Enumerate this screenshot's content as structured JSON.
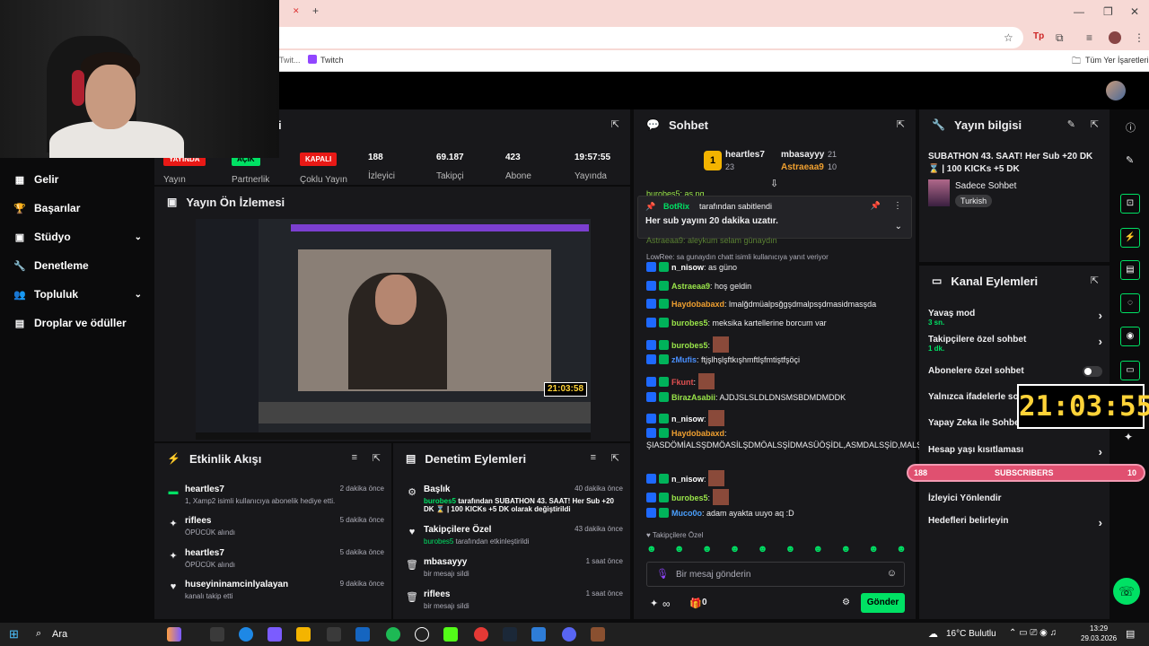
{
  "browser": {
    "bookmark_twitch": "Twitch",
    "bookmark_partial": "Twit...",
    "all_bookmarks": "Tüm Yer İşaretleri",
    "new_tab_icon": "plus-icon"
  },
  "sidebar": {
    "items": [
      {
        "label": "Gelir",
        "icon": "revenue-icon"
      },
      {
        "label": "Başarılar",
        "icon": "trophy-icon"
      },
      {
        "label": "Stüdyo",
        "icon": "studio-icon"
      },
      {
        "label": "Denetleme",
        "icon": "wrench-icon"
      },
      {
        "label": "Topluluk",
        "icon": "community-icon"
      },
      {
        "label": "Droplar ve ödüller",
        "icon": "gift-icon"
      }
    ]
  },
  "stats": {
    "title_partial": "i",
    "items": [
      {
        "badge": "YAYINDA",
        "label": "Yayın"
      },
      {
        "badge": "AÇIK",
        "label": "Partnerlik"
      },
      {
        "badge": "KAPALI",
        "label": "Çoklu Yayın"
      },
      {
        "value": "188",
        "label": "İzleyici"
      },
      {
        "value": "69.187",
        "label": "Takipçi"
      },
      {
        "value": "423",
        "label": "Abone"
      },
      {
        "value": "19:57:55",
        "label": "Yayında"
      }
    ]
  },
  "preview": {
    "title": "Yayın Ön İzlemesi",
    "inner_timer": "21:03:58"
  },
  "activity": {
    "title": "Etkinlik Akışı",
    "items": [
      {
        "name": "heartles7",
        "sub": "1, Xamp2 isimli kullanıcıya abonelik hediye etti.",
        "time": "2 dakika önce"
      },
      {
        "name": "riflees",
        "sub": "ÖPÜCÜK alındı",
        "time": "5 dakika önce"
      },
      {
        "name": "heartles7",
        "sub": "ÖPÜCÜK alındı",
        "time": "5 dakika önce"
      },
      {
        "name": "huseyininamcinlyalayan",
        "sub": "kanalı takip etti",
        "time": "9 dakika önce"
      }
    ]
  },
  "moderation": {
    "title": "Denetim Eylemleri",
    "items": [
      {
        "name": "Başlık",
        "sub_user": "burobes5",
        "sub": "tarafından SUBATHON 43. SAAT! Her Sub +20 DK ⌛ | 100 KICKs +5 DK olarak değiştirildi",
        "time": "40 dakika önce"
      },
      {
        "name": "Takipçilere Özel",
        "sub_user": "burobes5",
        "sub": "tarafından etkinleştirildi",
        "time": "43 dakika önce"
      },
      {
        "name": "mbasayyy",
        "sub": "bir mesajı sildi",
        "time": "1 saat önce"
      },
      {
        "name": "riflees",
        "sub": "bir mesajı sildi",
        "time": "1 saat önce"
      }
    ]
  },
  "chat": {
    "title": "Sohbet",
    "top": [
      {
        "rank": "1",
        "name": "heartles7",
        "count": "23"
      },
      {
        "name": "mbasayyy",
        "count": "21"
      },
      {
        "name": "Astraeaa9",
        "count": "10"
      }
    ],
    "pinned_by": "BotRix",
    "pinned_suffix": "tarafından sabitlendi",
    "pinned_text": "Her sub yayını 20 dakika uzatır.",
    "partial_top": "burobes5: as pg",
    "partial_hidden": "Astraeaa9: aleykum selam günaydın",
    "reply_note": "LowRee: sa gunaydın chatt isimli kullanıcıya yanıt veriyor",
    "messages": [
      {
        "user": "n_nisow",
        "text": "as güno",
        "color": "#ffffff"
      },
      {
        "user": "Astraeaa9",
        "text": "hoş geldin",
        "color": "#9ae64a"
      },
      {
        "user": "Haydobabaxd",
        "text": "lmalğdmüalpsğgşdmalpsşdmasidmasşda",
        "color": "#f0a030"
      },
      {
        "user": "burobes5",
        "text": "meksika kartellerine borcum var",
        "color": "#9ae64a"
      },
      {
        "user": "burobes5",
        "text": "",
        "color": "#9ae64a"
      },
      {
        "user": "zMufis",
        "text": "ftjşlhşlşftkışhmftlşfmtiştfşöçi",
        "color": "#4a90ff"
      },
      {
        "user": "Fkunt",
        "text": "",
        "color": "#e05050"
      },
      {
        "user": "BirazAsabii",
        "text": "AJDJSLSLDLDNSMSBDMDMDDK",
        "color": "#9ae64a"
      },
      {
        "user": "n_nisow",
        "text": "",
        "color": "#ffffff"
      },
      {
        "user": "Haydobabaxd",
        "text": "ŞIASDÖMİALSŞDMÖASİLŞDMÖALSŞİDMASÜÖŞİDL,ASMDALSŞİD,MALŞDMASD",
        "color": "#f0a030"
      },
      {
        "user": "n_nisow",
        "text": "",
        "color": "#ffffff"
      },
      {
        "user": "burobes5",
        "text": "",
        "color": "#9ae64a"
      },
      {
        "user": "Muco0o",
        "text": "adam ayakta uuyo aq :D",
        "color": "#4aa0ff"
      }
    ],
    "followers_only": "Takipçilere Özel",
    "input_placeholder": "Bir mesaj gönderin",
    "points": "0",
    "send_label": "Gönder",
    "infinity": "∞"
  },
  "info": {
    "title": "Yayın bilgisi",
    "stream_title": "SUBATHON 43. SAAT! Her Sub +20 DK ⌛ | 100 KICKs +5 DK",
    "category": "Sadece Sohbet",
    "tag": "Turkish"
  },
  "actions": {
    "title": "Kanal Eylemleri",
    "items": [
      {
        "label": "Yavaş mod",
        "sub": "3 sn.",
        "chev": true
      },
      {
        "label": "Takipçilere özel sohbet",
        "sub": "1 dk.",
        "chev": true
      },
      {
        "label": "Abonelere özel sohbet",
        "toggle": true
      },
      {
        "label": "Yalnızca ifadelerle sohbet"
      },
      {
        "label": "Yapay Zeka ile Sohbet"
      },
      {
        "label": "Hesap yaşı kısıtlaması",
        "chev": true
      },
      {
        "label": "İzleyici Yönlendir"
      },
      {
        "label": "Hedefleri belirleyin",
        "chev": true
      }
    ]
  },
  "overlay": {
    "timer": "21:03:55",
    "sub_left": "188",
    "sub_label": "SUBSCRIBERS",
    "sub_right": "10"
  },
  "taskbar": {
    "search": "Ara",
    "weather": "16°C Bulutlu",
    "time": "13:29",
    "date": "29.03.2026"
  },
  "colors": {
    "accent": "#00e164",
    "panel": "#18181b",
    "bg": "#0b0b0c"
  }
}
